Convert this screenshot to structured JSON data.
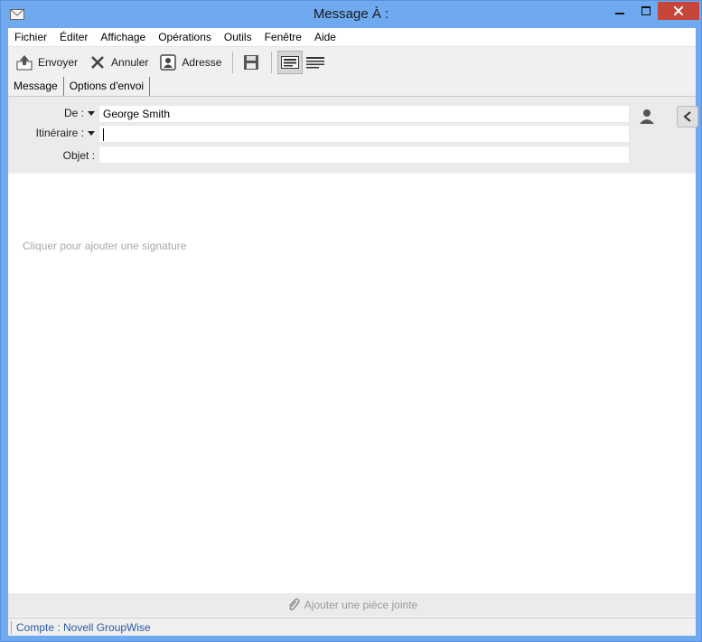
{
  "window": {
    "title": "Message À :"
  },
  "menu": [
    "Fichier",
    "Éditer",
    "Affichage",
    "Opérations",
    "Outils",
    "Fenêtre",
    "Aide"
  ],
  "toolbar": {
    "send_label": "Envoyer",
    "cancel_label": "Annuler",
    "address_label": "Adresse"
  },
  "tabs": [
    "Message",
    "Options d'envoi"
  ],
  "fields": {
    "from_label": "De :",
    "from_value": "George Smith",
    "route_label": "Itinéraire :",
    "route_value": "",
    "subject_label": "Objet :",
    "subject_value": ""
  },
  "body": {
    "signature_prompt": "Cliquer pour ajouter une signature"
  },
  "attach": {
    "label": "Ajouter une pièce jointe"
  },
  "status": {
    "account": "Compte : Novell GroupWise"
  },
  "icons": {
    "title": "envelope-icon",
    "send": "send-icon",
    "cancel": "x-icon",
    "address": "address-book-icon",
    "save": "floppy-disk-icon",
    "view_html": "html-view-icon",
    "view_text": "plain-text-view-icon",
    "contact": "person-icon",
    "collapse": "chevron-left-icon",
    "attach": "paperclip-icon"
  },
  "colors": {
    "titlebar": "#6faaf1",
    "close": "#c7463a",
    "status_text": "#2b5aa3"
  }
}
